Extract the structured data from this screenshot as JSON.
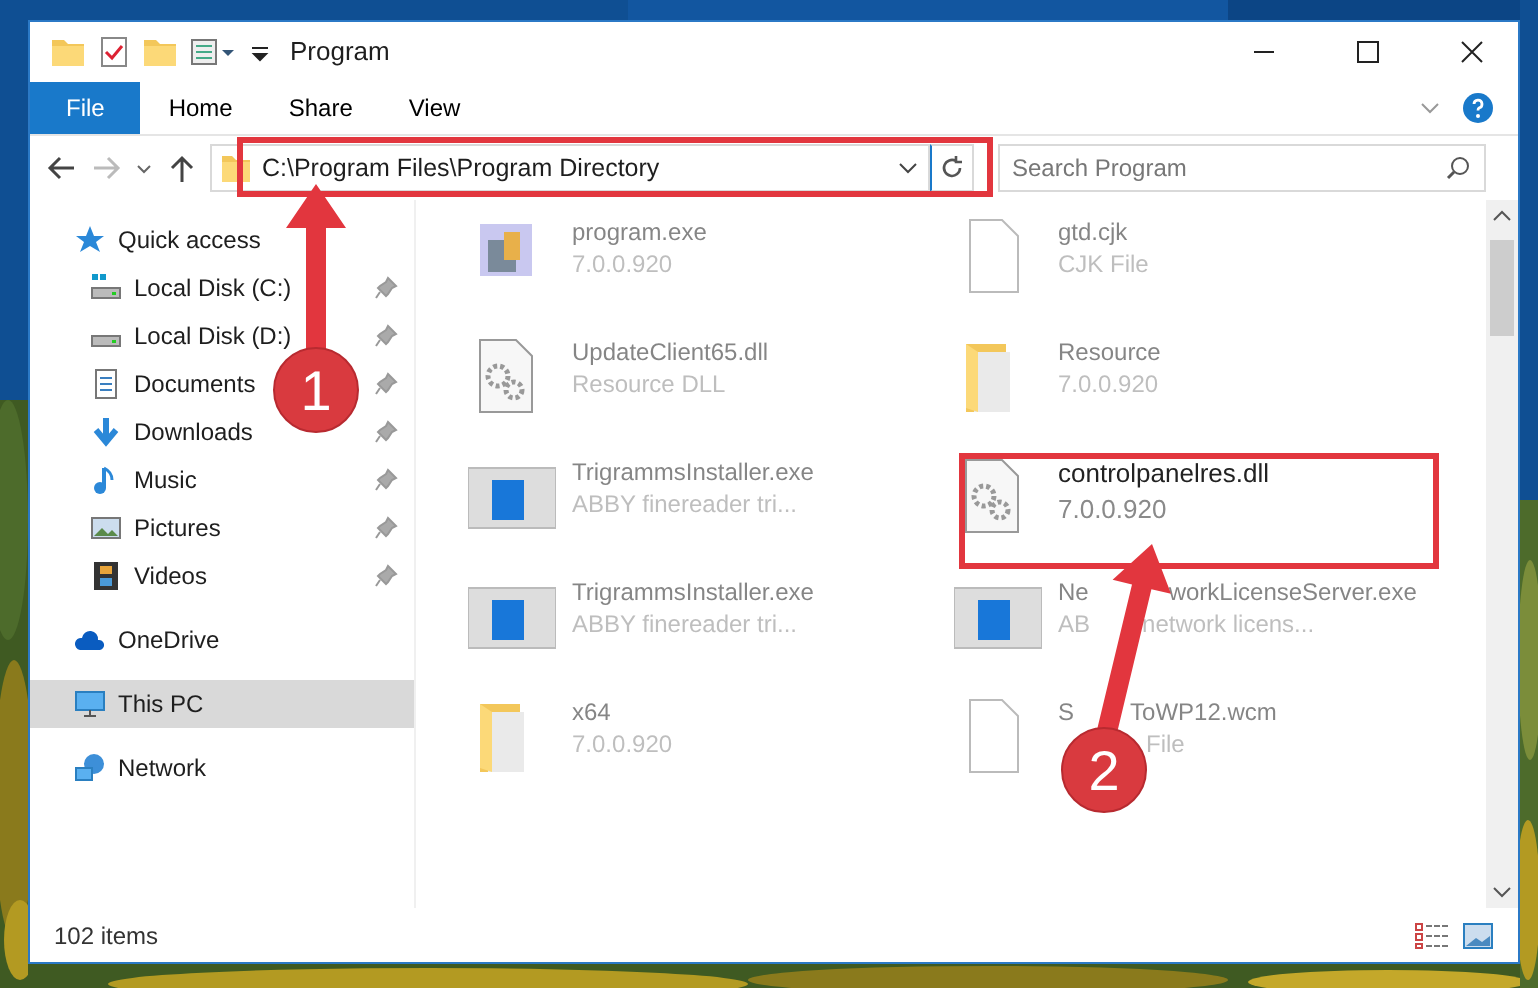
{
  "window": {
    "title": "Program"
  },
  "ribbon_tabs": [
    {
      "label": "File",
      "kind": "file",
      "selected": false
    },
    {
      "label": "Home",
      "kind": "tab",
      "selected": false
    },
    {
      "label": "Share",
      "kind": "tab",
      "selected": false
    },
    {
      "label": "View",
      "kind": "tab",
      "selected": false
    }
  ],
  "address_bar": {
    "path": "C:\\Program Files\\Program Directory"
  },
  "search": {
    "placeholder": "Search Program"
  },
  "sidebar": {
    "items": [
      {
        "label": "Quick access",
        "selected": false,
        "children": [
          {
            "label": "Local Disk (C:)",
            "pinned": true,
            "selected": false
          },
          {
            "label": "Local Disk (D:)",
            "pinned": true,
            "selected": false
          },
          {
            "label": "Documents",
            "pinned": true,
            "selected": false
          },
          {
            "label": "Downloads",
            "pinned": true,
            "selected": false
          },
          {
            "label": "Music",
            "pinned": true,
            "selected": false
          },
          {
            "label": "Pictures",
            "pinned": true,
            "selected": false
          },
          {
            "label": "Videos",
            "pinned": true,
            "selected": false
          }
        ]
      },
      {
        "label": "OneDrive",
        "selected": false
      },
      {
        "label": "This PC",
        "selected": true
      },
      {
        "label": "Network",
        "selected": false
      }
    ]
  },
  "files": [
    {
      "name": "program.exe",
      "detail": "7.0.0.920",
      "kind": "app",
      "highlighted": false
    },
    {
      "name": "gtd.cjk",
      "detail": "CJK File",
      "kind": "file",
      "highlighted": false
    },
    {
      "name": "UpdateClient65.dll",
      "detail": "Resource DLL",
      "kind": "dll",
      "highlighted": false
    },
    {
      "name": "Resource",
      "detail": "7.0.0.920",
      "kind": "folder",
      "highlighted": false
    },
    {
      "name": "TrigrammsInstaller.exe",
      "detail": "ABBY finereader tri...",
      "kind": "setup",
      "highlighted": false
    },
    {
      "name": "controlpanelres.dll",
      "detail": "7.0.0.920",
      "kind": "dll",
      "highlighted": true
    },
    {
      "name": "TrigrammsInstaller.exe",
      "detail": "ABBY finereader tri...",
      "kind": "setup",
      "highlighted": false
    },
    {
      "name": [
        {
          "text": "Ne"
        },
        {
          "text": "workLicenseServer.exe"
        }
      ],
      "detail": [
        {
          "text": "AB"
        },
        {
          "text": "network licens..."
        }
      ],
      "kind": "setup",
      "highlighted": false
    },
    {
      "name": "x64",
      "detail": "7.0.0.920",
      "kind": "folder",
      "highlighted": false
    },
    {
      "name": [
        {
          "text": "S"
        },
        {
          "text": "ToWP12.wcm"
        }
      ],
      "detail": [
        {
          "text": "File",
          "after_gap": true
        }
      ],
      "kind": "file",
      "highlighted": false
    }
  ],
  "status_bar": {
    "count": "102 items"
  },
  "annotations": [
    {
      "number": "1"
    },
    {
      "number": "2"
    }
  ]
}
